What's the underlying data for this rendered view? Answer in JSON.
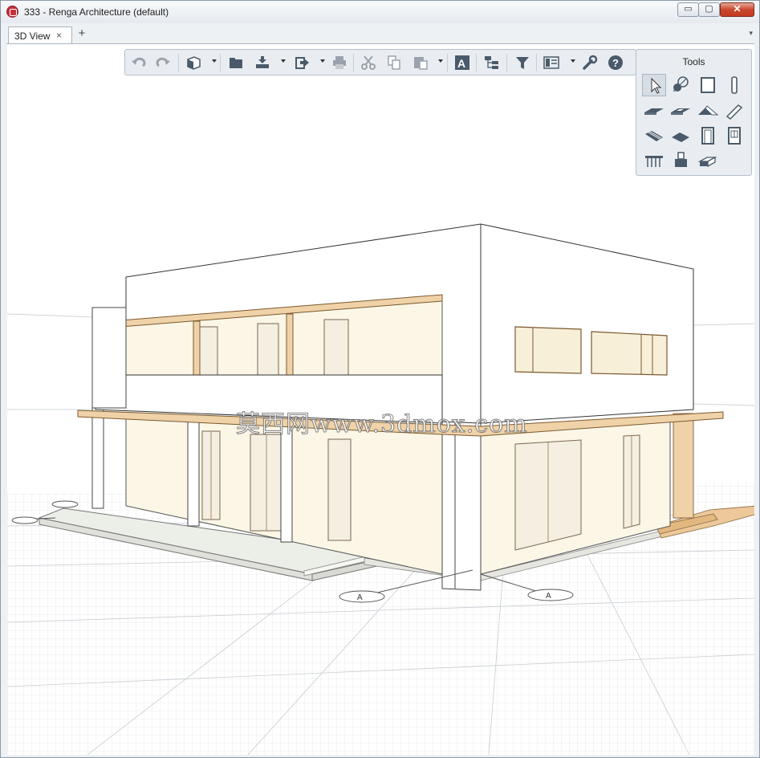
{
  "window": {
    "title": "333 - Renga Architecture (default)"
  },
  "window_controls": {
    "minimize": "▭",
    "maximize": "▢",
    "close": "✕"
  },
  "tabs": [
    {
      "label": "3D View",
      "close": "×"
    }
  ],
  "tab_add": "+",
  "tab_menu": "▾",
  "toolbar": {
    "buttons": [
      {
        "icon": "undo-icon"
      },
      {
        "icon": "redo-icon"
      },
      {
        "icon": "view-cube-icon"
      },
      {
        "icon": "open-folder-icon"
      },
      {
        "icon": "import-icon"
      },
      {
        "icon": "export-icon"
      },
      {
        "icon": "print-icon"
      },
      {
        "icon": "cut-icon"
      },
      {
        "icon": "copy-icon"
      },
      {
        "icon": "paste-icon"
      },
      {
        "icon": "text-style-icon"
      },
      {
        "icon": "structure-icon"
      },
      {
        "icon": "filter-icon"
      },
      {
        "icon": "layout-icon"
      },
      {
        "icon": "settings-icon"
      },
      {
        "icon": "help-icon"
      }
    ]
  },
  "tools": {
    "title": "Tools",
    "items": [
      {
        "icon": "select-cursor-icon",
        "active": true
      },
      {
        "icon": "axis-icon"
      },
      {
        "icon": "wall-icon"
      },
      {
        "icon": "column-icon"
      },
      {
        "icon": "floor-icon"
      },
      {
        "icon": "opening-icon"
      },
      {
        "icon": "roof-icon"
      },
      {
        "icon": "beam-icon"
      },
      {
        "icon": "stair-icon"
      },
      {
        "icon": "ramp-icon"
      },
      {
        "icon": "door-icon"
      },
      {
        "icon": "window-icon"
      },
      {
        "icon": "railing-icon"
      },
      {
        "icon": "equipment-icon"
      },
      {
        "icon": "element-icon"
      }
    ]
  },
  "axis_markers": [
    "A",
    "A"
  ],
  "watermark": "莫西网www.3dmox.com",
  "colors": {
    "accent": "#c5303b",
    "wood": "#f0d2a8",
    "wall_interior": "#fbf6e6"
  }
}
